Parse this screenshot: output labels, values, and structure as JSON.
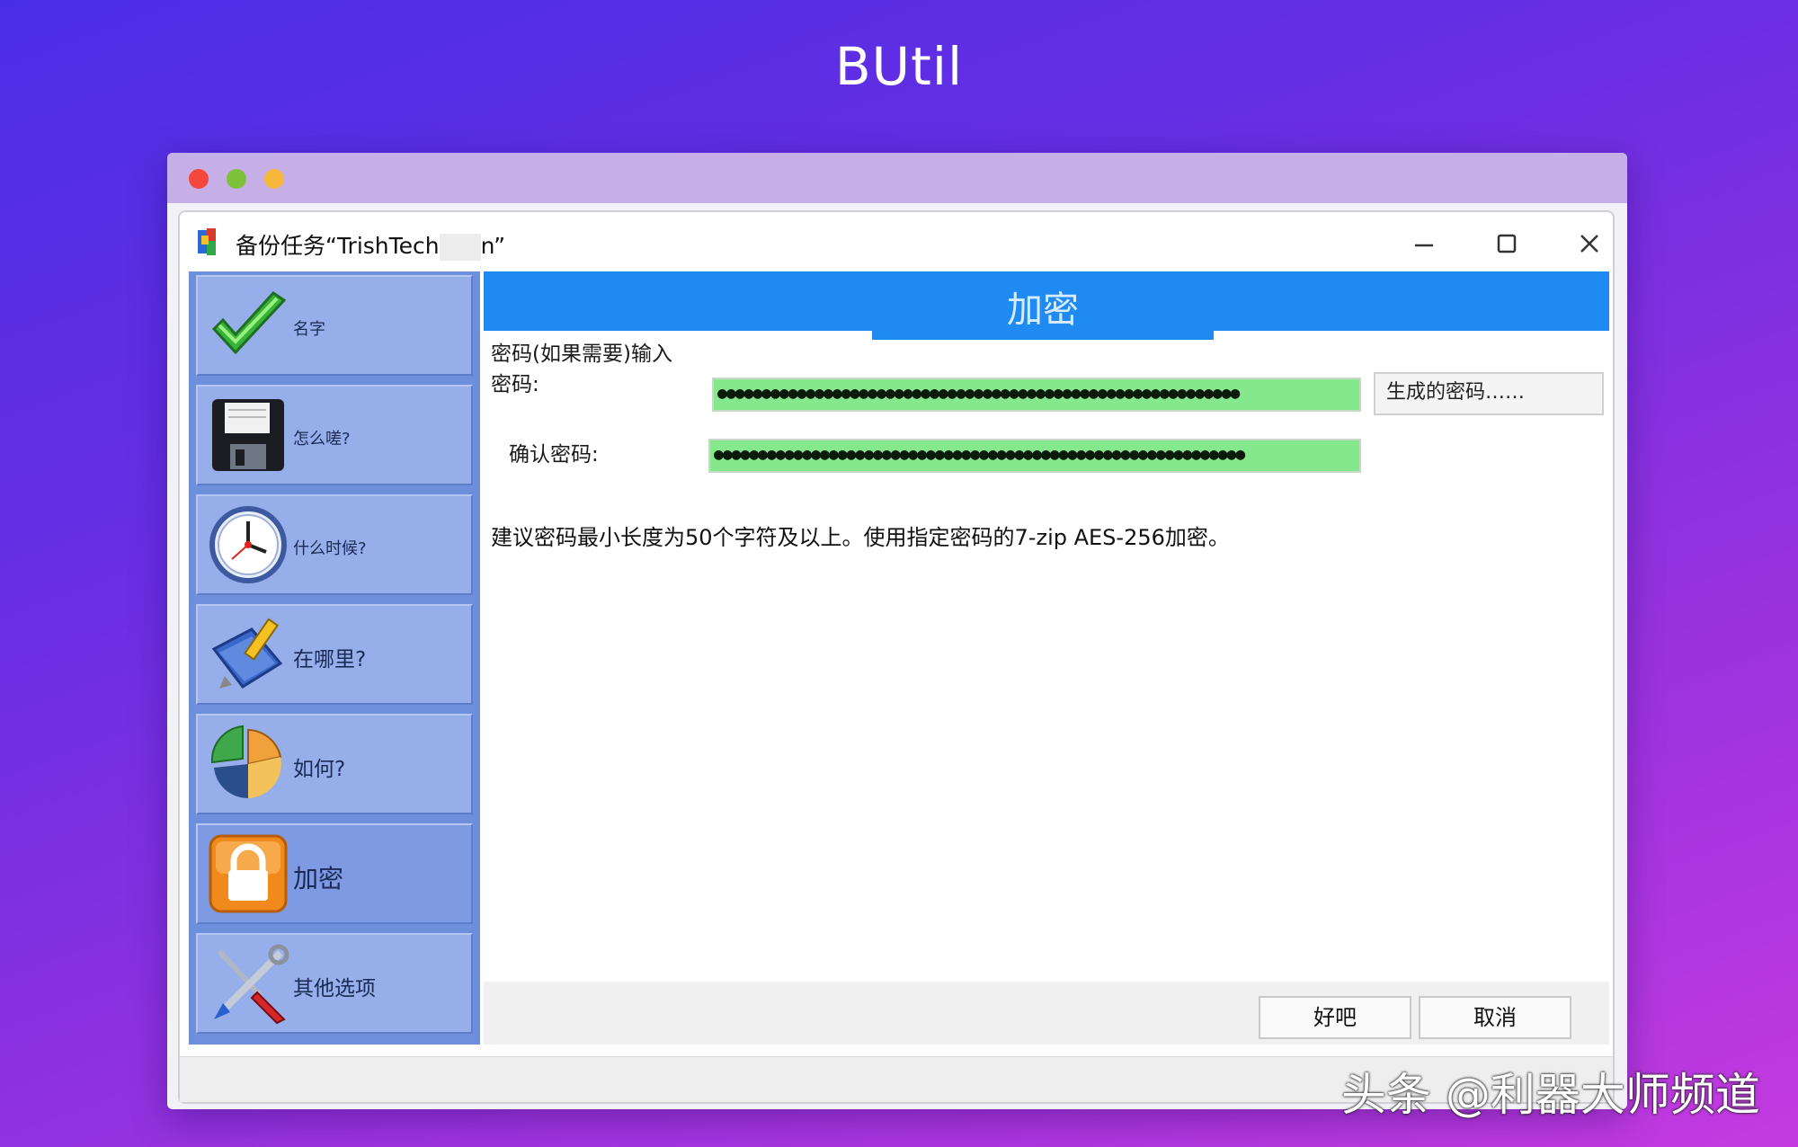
{
  "app_title": "BUtil",
  "window": {
    "title": "备份任务“TrishTech",
    "title_end": "n”"
  },
  "sidebar": {
    "items": [
      {
        "label": "名字",
        "icon": "checkmark-icon"
      },
      {
        "label": "怎么嗟?",
        "icon": "floppy-disk-icon"
      },
      {
        "label": "什么时候?",
        "icon": "clock-icon"
      },
      {
        "label": "在哪里?",
        "icon": "folder-pencil-icon"
      },
      {
        "label": "如何?",
        "icon": "pie-chart-icon"
      },
      {
        "label": "加密",
        "icon": "lock-icon",
        "active": true
      },
      {
        "label": "其他选项",
        "icon": "tools-icon"
      }
    ]
  },
  "panel": {
    "title": "加密",
    "password_label_line1": "密码(如果需要)输入",
    "password_label_line2": "密码:",
    "password_value": "●●●●●●●●●●●●●●●●●●●●●●●●●●●●●●●●●●●●●●●●●●●●●●●●●●●●●●●●●●●",
    "generate_button": "生成的密码……",
    "confirm_label": "确认密码:",
    "confirm_value": "●●●●●●●●●●●●●●●●●●●●●●●●●●●●●●●●●●●●●●●●●●●●●●●●●●●●●●●●●●●●",
    "hint": "建议密码最小长度为50个字符及以上。使用指定密码的7-zip AES-256加密。",
    "field_color": "#86e88c"
  },
  "footer": {
    "ok_label": "好吧",
    "cancel_label": "取消"
  },
  "watermark": "头条 @利器大师频道",
  "colors": {
    "banner": "#1f8bf2",
    "sidebar": "#6e8fdb",
    "mac_close": "#f5473c",
    "mac_min": "#7ec23a",
    "mac_max": "#f6b73c"
  }
}
